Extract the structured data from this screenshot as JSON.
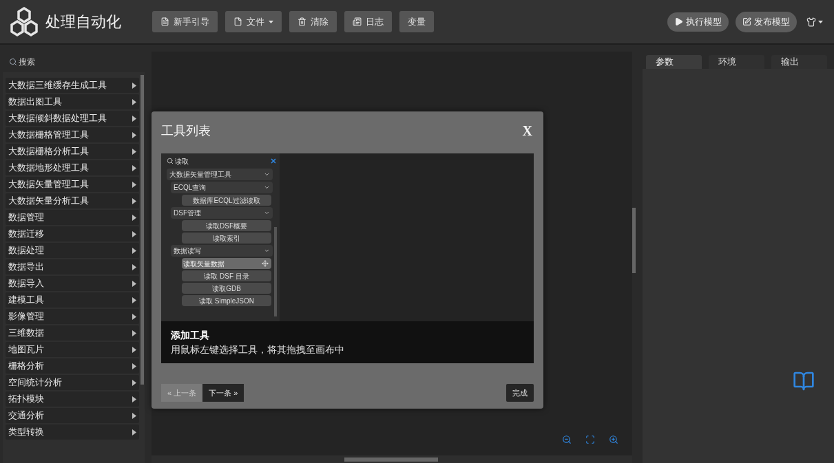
{
  "app": {
    "title": "处理自动化"
  },
  "toolbar": [
    {
      "label": "新手引导",
      "dropdown": false
    },
    {
      "label": "文件",
      "dropdown": true
    },
    {
      "label": "清除",
      "dropdown": false
    },
    {
      "label": "日志",
      "dropdown": false
    },
    {
      "label": "变量",
      "dropdown": false
    }
  ],
  "actions": [
    {
      "label": "执行模型"
    },
    {
      "label": "发布模型"
    }
  ],
  "sidebar": {
    "search_placeholder": "搜索",
    "items": [
      "大数据三维缓存生成工具",
      "数据出图工具",
      "大数据倾斜数据处理工具",
      "大数据栅格管理工具",
      "大数据栅格分析工具",
      "大数据地形处理工具",
      "大数据矢量管理工具",
      "大数据矢量分析工具",
      "数据管理",
      "数据迁移",
      "数据处理",
      "数据导出",
      "数据导入",
      "建模工具",
      "影像管理",
      "三维数据",
      "地图瓦片",
      "栅格分析",
      "空间统计分析",
      "拓扑模块",
      "交通分析",
      "类型转换"
    ]
  },
  "right_panel": {
    "tabs": [
      {
        "label": "参数",
        "selected": true
      },
      {
        "label": "环境",
        "selected": false
      },
      {
        "label": "输出",
        "selected": false
      }
    ]
  },
  "dialog": {
    "title": "工具列表",
    "close": "X",
    "screenshot": {
      "search_value": "读取",
      "tree": [
        {
          "kind": "category",
          "label": "大数据矢量管理工具",
          "expanded": true,
          "children": [
            {
              "kind": "category",
              "label": "ECQL查询",
              "expanded": true,
              "children": [
                {
                  "kind": "tool",
                  "label": "数据库ECQL过滤读取",
                  "hovered": false
                }
              ]
            },
            {
              "kind": "category",
              "label": "DSF管理",
              "expanded": true,
              "children": [
                {
                  "kind": "tool",
                  "label": "读取DSF概要",
                  "hovered": false
                },
                {
                  "kind": "tool",
                  "label": "读取索引",
                  "hovered": false
                }
              ]
            },
            {
              "kind": "category",
              "label": "数据读写",
              "expanded": true,
              "children": [
                {
                  "kind": "tool",
                  "label": "读取矢量数据",
                  "hovered": true
                },
                {
                  "kind": "tool",
                  "label": "读取 DSF 目录",
                  "hovered": false
                },
                {
                  "kind": "tool",
                  "label": "读取GDB",
                  "hovered": false
                },
                {
                  "kind": "tool",
                  "label": "读取 SimpleJSON",
                  "hovered": false
                }
              ]
            }
          ]
        }
      ]
    },
    "caption": {
      "title": "添加工具",
      "text": "用鼠标左键选择工具，将其拖拽至画布中"
    },
    "prev": {
      "label": "« 上一条",
      "disabled": true
    },
    "next": {
      "label": "下一条 »",
      "disabled": false
    },
    "done": "完成"
  }
}
